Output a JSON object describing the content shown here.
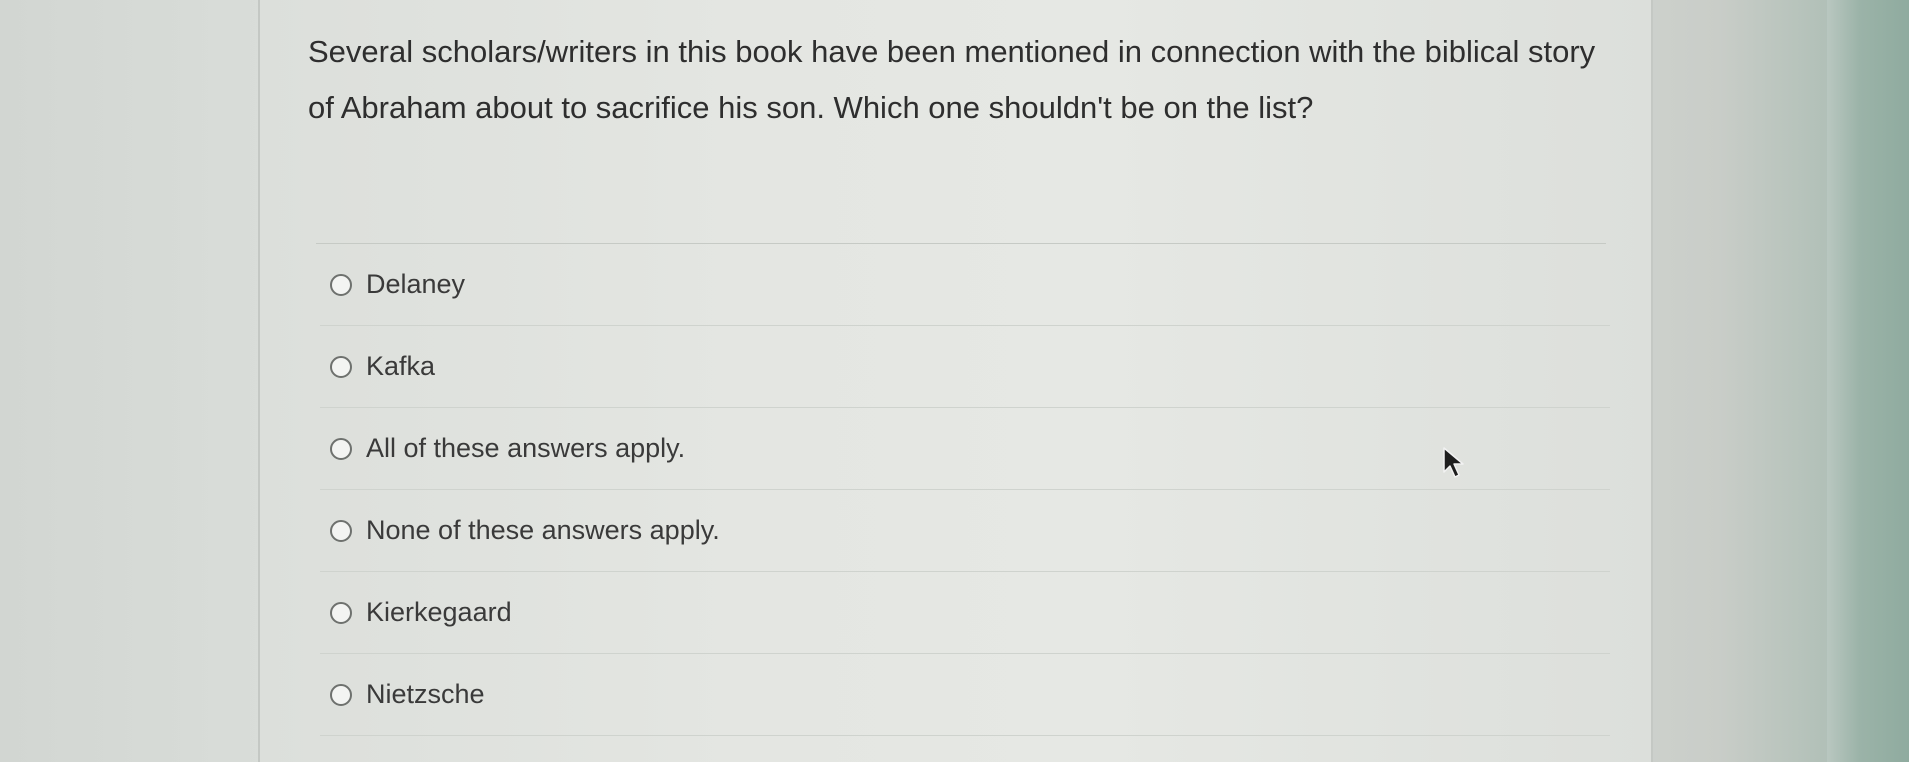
{
  "question": {
    "text": "Several scholars/writers in this book have been mentioned in connection with the biblical story of Abraham about to sacrifice his son. Which one shouldn't be on the list?"
  },
  "answers": [
    {
      "label": "Delaney",
      "selected": false
    },
    {
      "label": "Kafka",
      "selected": false
    },
    {
      "label": "All of these answers apply.",
      "selected": false
    },
    {
      "label": "None of these answers apply.",
      "selected": false
    },
    {
      "label": "Kierkegaard",
      "selected": false
    },
    {
      "label": "Nietzsche",
      "selected": false
    }
  ],
  "icons": {
    "radio": "radio-unselected-icon",
    "cursor": "mouse-pointer-icon"
  },
  "colors": {
    "text": "#2e2e2e",
    "radio_border": "#6e716e"
  }
}
